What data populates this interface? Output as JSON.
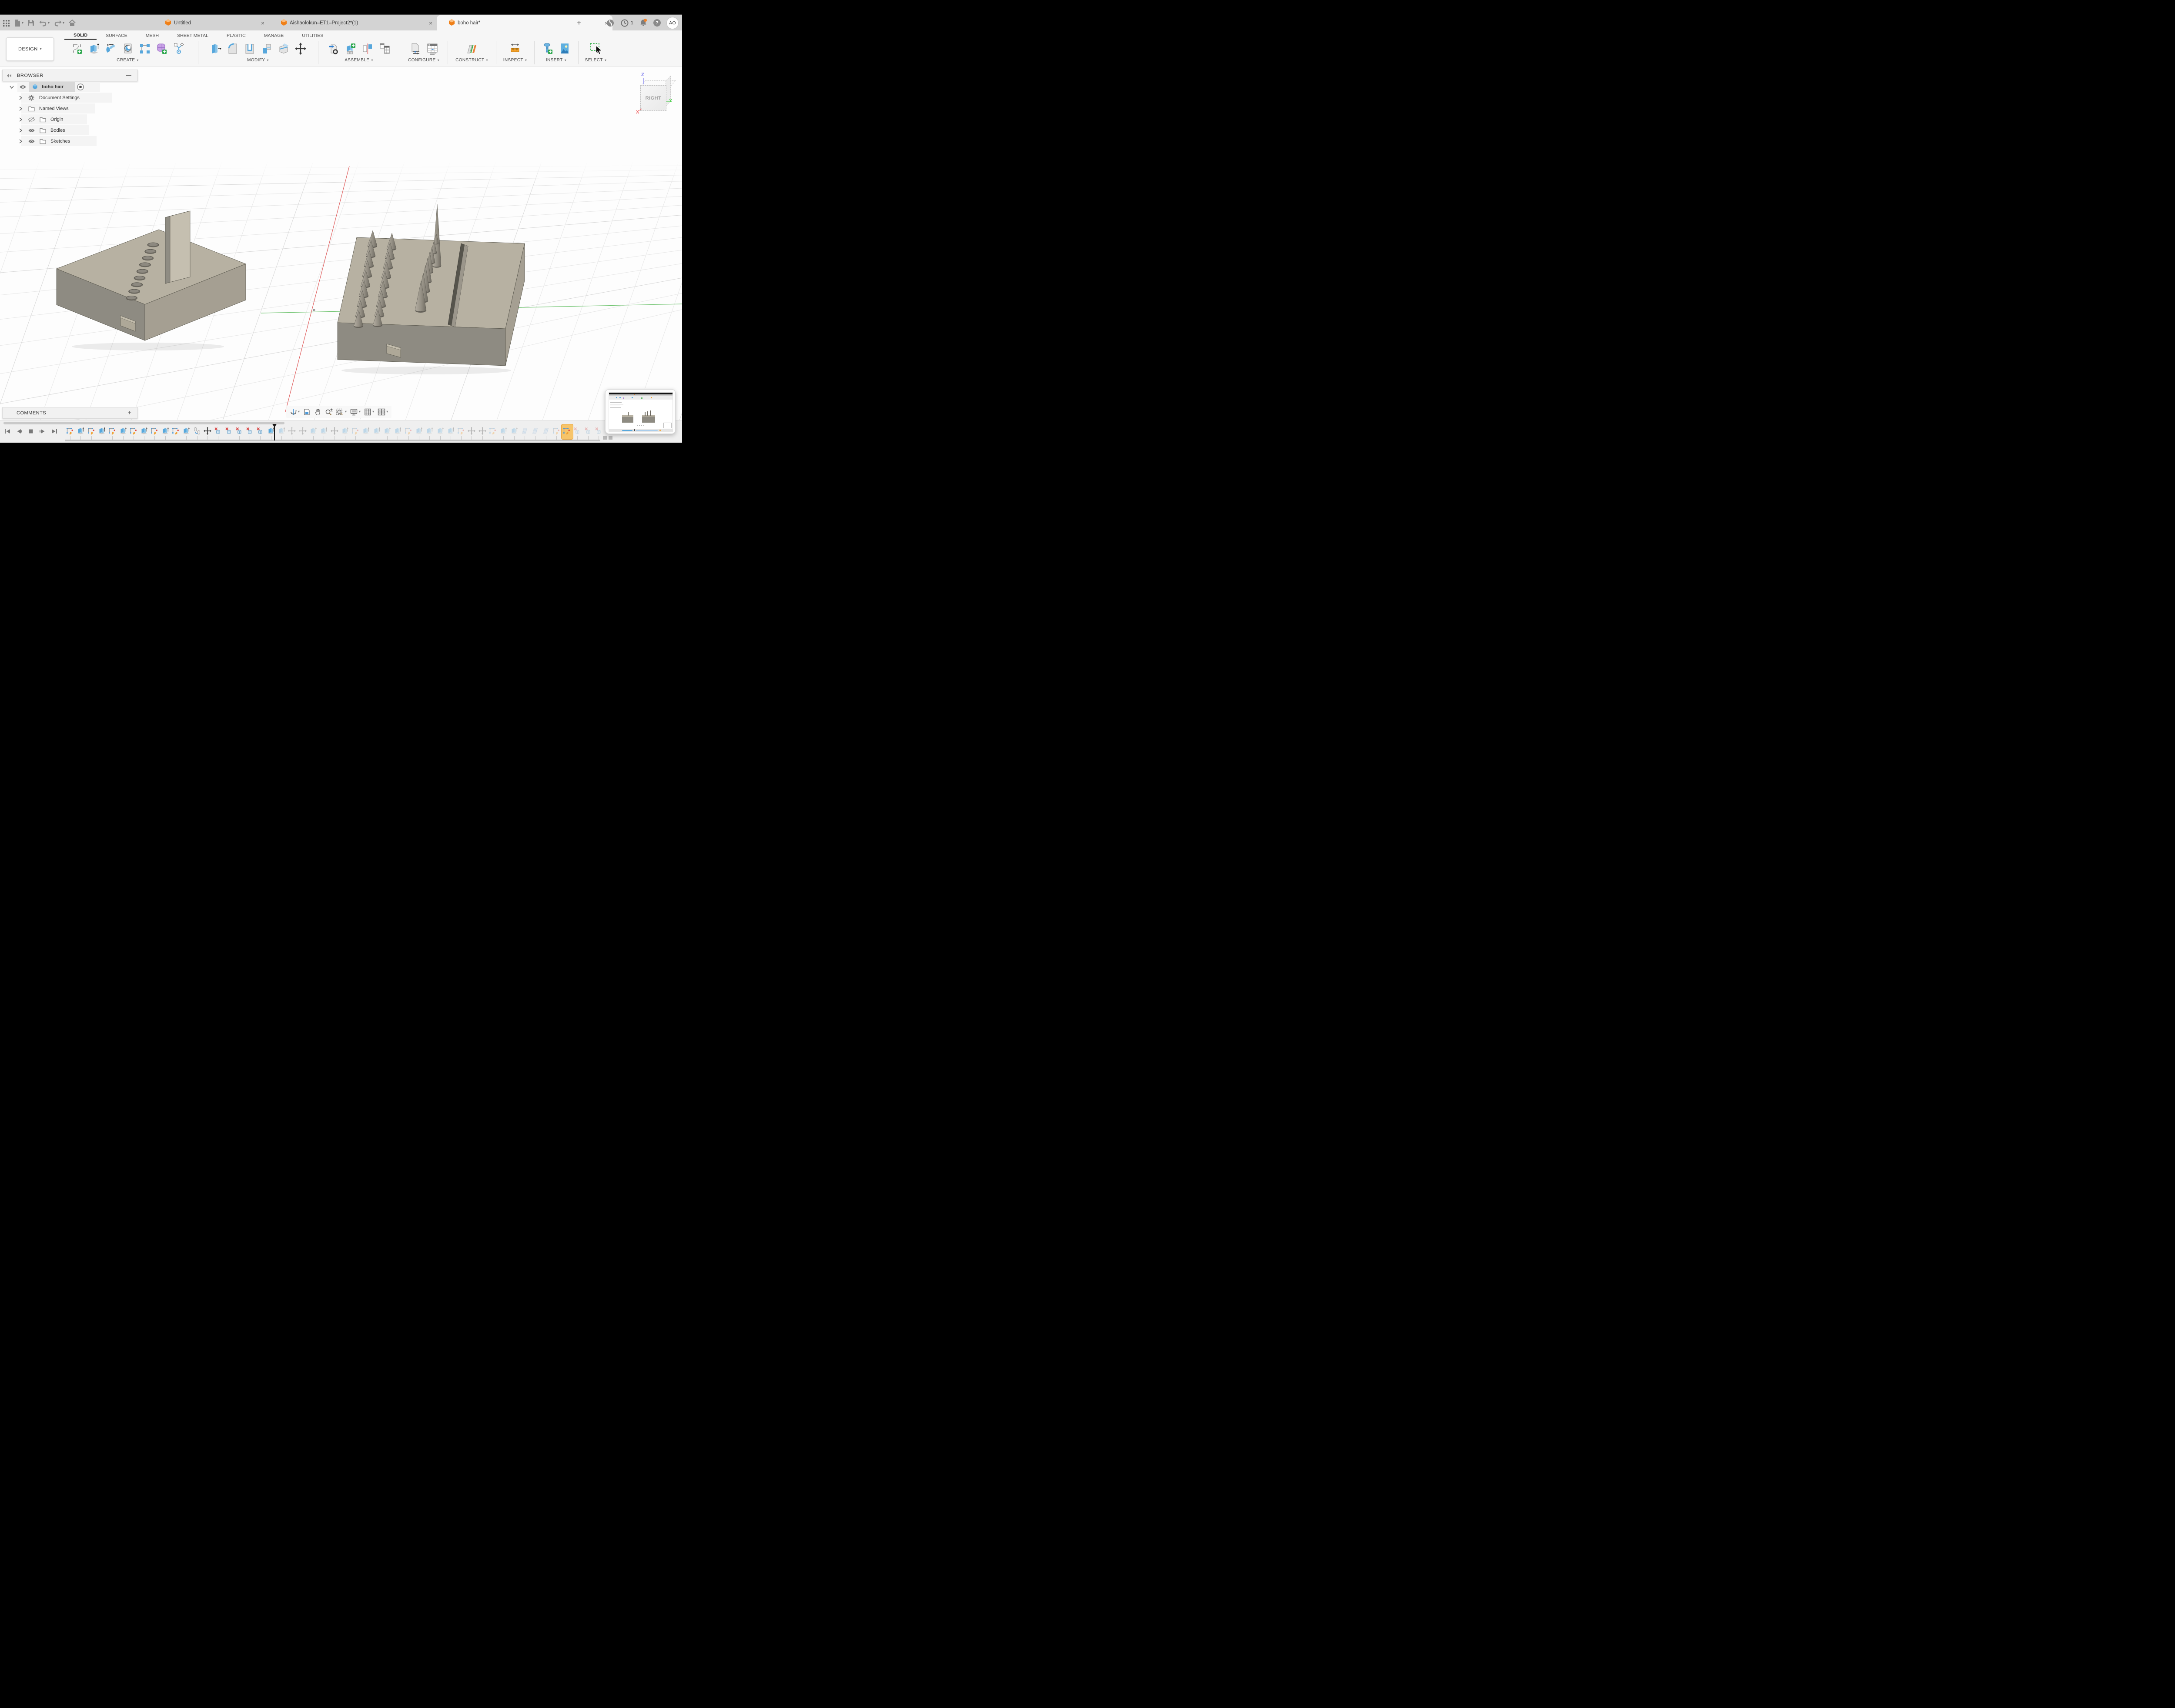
{
  "tabbar": {
    "quick": [
      {
        "name": "app-launcher",
        "icon": "grid9"
      },
      {
        "name": "file-menu",
        "icon": "file",
        "dropdown": true
      },
      {
        "name": "save",
        "icon": "save"
      },
      {
        "name": "undo",
        "icon": "undo",
        "dropdown": true
      },
      {
        "name": "redo",
        "icon": "redo",
        "dropdown": true
      },
      {
        "name": "home",
        "icon": "home"
      }
    ],
    "tabs": [
      {
        "label": "Untitled",
        "active": false
      },
      {
        "label": "Aishaolokun–ET1–Project2*(1)",
        "active": false
      },
      {
        "label": "boho hair*",
        "active": true
      }
    ],
    "new_tab": "+",
    "right": [
      {
        "name": "job-status",
        "icon": "globe"
      },
      {
        "name": "version-history",
        "icon": "clock",
        "badge": "1"
      },
      {
        "name": "notifications",
        "icon": "bell",
        "dot": true
      },
      {
        "name": "help",
        "icon": "help",
        "glyph": "?"
      },
      {
        "name": "account",
        "icon": "avatar",
        "initials": "AO"
      }
    ]
  },
  "ribbon": {
    "tabs": [
      {
        "label": "SOLID",
        "active": true
      },
      {
        "label": "SURFACE"
      },
      {
        "label": "MESH"
      },
      {
        "label": "SHEET METAL"
      },
      {
        "label": "PLASTIC"
      },
      {
        "label": "MANAGE"
      },
      {
        "label": "UTILITIES"
      }
    ]
  },
  "toolbar": {
    "design_label": "DESIGN",
    "groups": [
      {
        "label": "CREATE",
        "icons": [
          "create-sketch",
          "extrude",
          "revolve",
          "hole",
          "pattern",
          "create-form",
          "derive"
        ]
      },
      {
        "label": "MODIFY",
        "icons": [
          "press-pull",
          "fillet",
          "shell",
          "combine",
          "split-body",
          "move-copy"
        ]
      },
      {
        "label": "ASSEMBLE",
        "icons": [
          "insert-link",
          "new-component",
          "joint",
          "bom"
        ]
      },
      {
        "label": "CONFIGURE",
        "icons": [
          "configuration",
          "configuration-table"
        ]
      },
      {
        "label": "CONSTRUCT",
        "icons": [
          "construct-plane"
        ]
      },
      {
        "label": "INSPECT",
        "icons": [
          "measure"
        ]
      },
      {
        "label": "INSERT",
        "icons": [
          "insert-fastener",
          "canvas"
        ]
      },
      {
        "label": "SELECT",
        "icons": [
          "select-window"
        ]
      }
    ]
  },
  "browser": {
    "title": "BROWSER",
    "rows": [
      {
        "expander": "down",
        "vis": "eye",
        "icon": "cube",
        "label": "boho hair",
        "selected": true,
        "radio": true
      },
      {
        "expander": "right",
        "icon": "gear",
        "label": "Document Settings",
        "band": 210
      },
      {
        "expander": "right",
        "icon": "folder",
        "label": "Named Views",
        "band": 170
      },
      {
        "expander": "right",
        "vis": "eye-off",
        "icon": "folder",
        "label": "Origin",
        "band": 152
      },
      {
        "expander": "right",
        "vis": "eye",
        "icon": "folder",
        "label": "Bodies",
        "band": 157
      },
      {
        "expander": "right",
        "vis": "eye",
        "icon": "folder",
        "label": "Sketches",
        "band": 174
      }
    ]
  },
  "viewcube": {
    "face": "RIGHT",
    "axis_z": "Z",
    "axis_y": "Y",
    "axis_x": "X"
  },
  "comments": {
    "title": "COMMENTS",
    "add": "+"
  },
  "navbar": {
    "items": [
      {
        "name": "orbit",
        "dropdown": true
      },
      {
        "name": "look-at"
      },
      {
        "name": "pan"
      },
      {
        "name": "zoom"
      },
      {
        "name": "fit",
        "dropdown": true
      },
      {
        "name": "display-settings",
        "dropdown": true
      },
      {
        "name": "layout-grid",
        "dropdown": true
      },
      {
        "name": "viewports",
        "dropdown": true
      }
    ]
  },
  "timeline": {
    "playback": [
      "skip-start",
      "step-back",
      "stop",
      "step-forward",
      "skip-end"
    ],
    "playhead_after_index": 19,
    "items": [
      {
        "type": "sketch",
        "state": "done"
      },
      {
        "type": "extrude",
        "state": "done"
      },
      {
        "type": "sketch",
        "state": "done"
      },
      {
        "type": "extrude",
        "state": "done"
      },
      {
        "type": "sketch",
        "state": "done"
      },
      {
        "type": "extrude",
        "state": "done"
      },
      {
        "type": "sketch",
        "state": "done"
      },
      {
        "type": "extrude",
        "state": "done"
      },
      {
        "type": "sketch",
        "state": "done"
      },
      {
        "type": "extrude",
        "state": "done"
      },
      {
        "type": "sketch",
        "state": "done"
      },
      {
        "type": "extrude",
        "state": "done"
      },
      {
        "type": "copy",
        "state": "done"
      },
      {
        "type": "move",
        "state": "done"
      },
      {
        "type": "delete",
        "state": "done"
      },
      {
        "type": "delete",
        "state": "done"
      },
      {
        "type": "delete",
        "state": "done"
      },
      {
        "type": "delete",
        "state": "done"
      },
      {
        "type": "delete",
        "state": "done"
      },
      {
        "type": "extrude",
        "state": "done"
      },
      {
        "type": "extrude",
        "state": "suppressed"
      },
      {
        "type": "move",
        "state": "suppressed"
      },
      {
        "type": "move",
        "state": "suppressed"
      },
      {
        "type": "extrude",
        "state": "suppressed"
      },
      {
        "type": "extrude",
        "state": "suppressed"
      },
      {
        "type": "move",
        "state": "suppressed"
      },
      {
        "type": "extrude",
        "state": "suppressed"
      },
      {
        "type": "sketch",
        "state": "suppressed"
      },
      {
        "type": "extrude",
        "state": "suppressed"
      },
      {
        "type": "extrude",
        "state": "suppressed"
      },
      {
        "type": "extrude",
        "state": "suppressed"
      },
      {
        "type": "extrude",
        "state": "suppressed"
      },
      {
        "type": "sketch",
        "state": "suppressed"
      },
      {
        "type": "extrude",
        "state": "suppressed"
      },
      {
        "type": "extrude",
        "state": "suppressed"
      },
      {
        "type": "extrude",
        "state": "suppressed"
      },
      {
        "type": "extrude",
        "state": "suppressed"
      },
      {
        "type": "sketch",
        "state": "suppressed"
      },
      {
        "type": "move",
        "state": "suppressed"
      },
      {
        "type": "move",
        "state": "suppressed"
      },
      {
        "type": "sketch",
        "state": "suppressed"
      },
      {
        "type": "extrude",
        "state": "suppressed"
      },
      {
        "type": "extrude",
        "state": "suppressed"
      },
      {
        "type": "plane",
        "state": "suppressed"
      },
      {
        "type": "plane",
        "state": "suppressed"
      },
      {
        "type": "plane",
        "state": "suppressed"
      },
      {
        "type": "sketch",
        "state": "suppressed"
      },
      {
        "type": "sketch",
        "state": "editing"
      },
      {
        "type": "delete",
        "state": "suppressed"
      },
      {
        "type": "delete",
        "state": "suppressed"
      },
      {
        "type": "delete",
        "state": "suppressed"
      }
    ]
  },
  "colors": {
    "accent_orange": "#f28a24",
    "select_green": "#37b24d",
    "extrude_blue": "#58a8dc",
    "axis_x": "#e06060",
    "axis_y": "#6cc26c",
    "axis_z": "#8585f0",
    "notification_dot": "#f2832a"
  }
}
